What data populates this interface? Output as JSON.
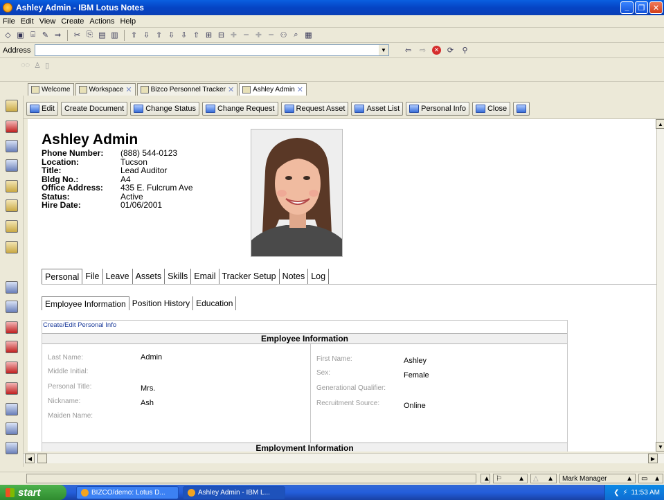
{
  "window": {
    "title": "Ashley Admin - IBM Lotus Notes"
  },
  "menu": [
    "File",
    "Edit",
    "View",
    "Create",
    "Actions",
    "Help"
  ],
  "address": {
    "label": "Address",
    "value": ""
  },
  "doc_tabs": [
    {
      "label": "Welcome",
      "active": false
    },
    {
      "label": "Workspace",
      "active": false
    },
    {
      "label": "Bizco Personnel Tracker",
      "active": false
    },
    {
      "label": "Ashley Admin",
      "active": true
    }
  ],
  "actions": [
    "Edit",
    "Create Document",
    "Change Status",
    "Change Request",
    "Request Asset",
    "Asset List",
    "Personal Info",
    "Close"
  ],
  "person": {
    "name": "Ashley Admin",
    "fields": [
      {
        "label": "Phone Number:",
        "value": "(888) 544-0123"
      },
      {
        "label": "Location:",
        "value": "Tucson"
      },
      {
        "label": "Title:",
        "value": "Lead Auditor"
      },
      {
        "label": "Bldg No.:",
        "value": "A4"
      },
      {
        "label": "Office Address:",
        "value": "435 E. Fulcrum Ave"
      },
      {
        "label": "Status:",
        "value": "Active"
      },
      {
        "label": "Hire Date:",
        "value": "01/06/2001"
      }
    ]
  },
  "main_tabs": [
    {
      "label": "Personal",
      "active": true
    },
    {
      "label": "File",
      "active": false
    },
    {
      "label": "Leave",
      "active": false
    },
    {
      "label": "Assets",
      "active": false
    },
    {
      "label": "Skills",
      "active": false
    },
    {
      "label": "Email",
      "active": false
    },
    {
      "label": "Tracker Setup",
      "active": false
    },
    {
      "label": "Notes",
      "active": false
    },
    {
      "label": "Log",
      "active": false
    }
  ],
  "sub_tabs": [
    {
      "label": "Employee Information",
      "active": true
    },
    {
      "label": "Position History",
      "active": false
    },
    {
      "label": "Education",
      "active": false
    }
  ],
  "edit_link": "Create/Edit Personal Info",
  "sections": {
    "employee": "Employee Information",
    "employment": "Employment Information"
  },
  "employee_left": [
    {
      "label": "Last Name:",
      "value": "Admin"
    },
    {
      "label": "Middle Initial:",
      "value": ""
    },
    {
      "label": "Personal Title:",
      "value": "Mrs."
    },
    {
      "label": "Nickname:",
      "value": "Ash"
    },
    {
      "label": "Maiden Name:",
      "value": ""
    }
  ],
  "employee_right": [
    {
      "label": "First Name:",
      "value": "Ashley"
    },
    {
      "label": "Sex:",
      "value": "Female"
    },
    {
      "label": "Generational Qualifier:",
      "value": ""
    },
    {
      "label": "Recruitment Source:",
      "value": "Online"
    }
  ],
  "status": {
    "location": "Mark Manager"
  },
  "taskbar": {
    "start": "start",
    "tasks": [
      {
        "label": "BIZCO/demo: Lotus D...",
        "active": false
      },
      {
        "label": "Ashley Admin - IBM L...",
        "active": true
      }
    ],
    "clock": "11:53 AM"
  },
  "colors": {
    "title_bar": "#0a5fe0",
    "taskbar": "#245edb",
    "start_button": "#3d9a3d",
    "link": "#1a3a9a"
  }
}
